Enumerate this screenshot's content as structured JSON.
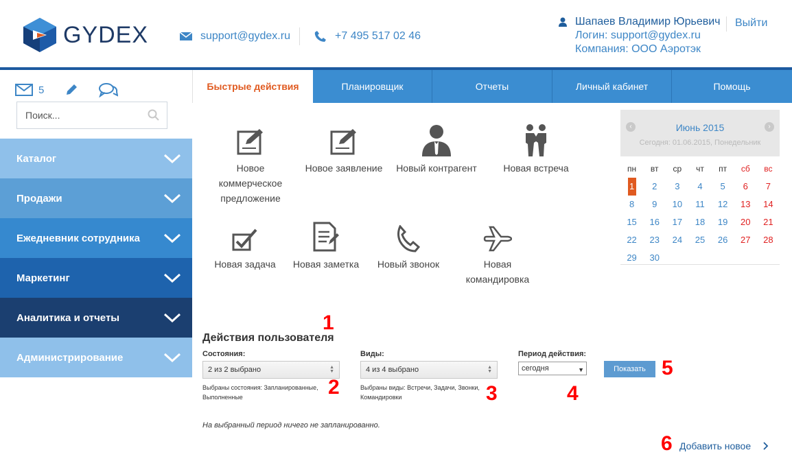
{
  "header": {
    "logo_text": "GYDEX",
    "email": "support@gydex.ru",
    "phone": "+7 495 517 02 46",
    "user_name": "Шапаев Владимир Юрьевич",
    "login_line": "Логин: support@gydex.ru",
    "company_line": "Компания: ООО Аэротэк",
    "logout": "Выйти"
  },
  "sidebar": {
    "mail_count": "5",
    "search_placeholder": "Поиск...",
    "menu": [
      {
        "label": "Каталог"
      },
      {
        "label": "Продажи"
      },
      {
        "label": "Ежедневник сотрудника"
      },
      {
        "label": "Маркетинг"
      },
      {
        "label": "Аналитика и отчеты"
      },
      {
        "label": "Администрирование"
      }
    ]
  },
  "tabs": [
    {
      "label": "Быстрые действия"
    },
    {
      "label": "Планировщик"
    },
    {
      "label": "Отчеты"
    },
    {
      "label": "Личный кабинет"
    },
    {
      "label": "Помощь"
    }
  ],
  "quick_actions": [
    {
      "label": "Новое коммерческое предложение",
      "icon": "document-pen-icon"
    },
    {
      "label": "Новое заявление",
      "icon": "document-pen-icon"
    },
    {
      "label": "Новый контрагент",
      "icon": "person-tie-icon"
    },
    {
      "label": "Новая встреча",
      "icon": "handshake-icon"
    },
    {
      "label": "Новая задача",
      "icon": "checkbox-icon"
    },
    {
      "label": "Новая заметка",
      "icon": "note-pen-icon"
    },
    {
      "label": "Новый звонок",
      "icon": "phone-icon"
    },
    {
      "label": "Новая командировка",
      "icon": "airplane-icon"
    }
  ],
  "calendar": {
    "title": "Июнь 2015",
    "subtitle": "Сегодня: 01.06.2015, Понедельник",
    "weekdays": [
      "пн",
      "вт",
      "ср",
      "чт",
      "пт",
      "сб",
      "вс"
    ],
    "weeks": [
      [
        "1",
        "2",
        "3",
        "4",
        "5",
        "6",
        "7"
      ],
      [
        "8",
        "9",
        "10",
        "11",
        "12",
        "13",
        "14"
      ],
      [
        "15",
        "16",
        "17",
        "18",
        "19",
        "20",
        "21"
      ],
      [
        "22",
        "23",
        "24",
        "25",
        "26",
        "27",
        "28"
      ],
      [
        "29",
        "30",
        "",
        "",
        "",
        "",
        ""
      ]
    ],
    "today": "1"
  },
  "user_actions": {
    "title": "Действия пользователя",
    "states_label": "Состояния:",
    "states_value": "2 из 2 выбрано",
    "states_note_1": "Выбраны состояния: Запланированные,",
    "states_note_2": "Выполненные",
    "types_label": "Виды:",
    "types_value": "4 из 4 выбрано",
    "types_note_1": "Выбраны виды: Встречи, Задачи, Звонки,",
    "types_note_2": "Командировки",
    "period_label": "Период действия:",
    "period_value": "сегодня",
    "show_button": "Показать",
    "empty_message": "На выбранный период ничего не запланированно.",
    "add_new": "Добавить новое"
  },
  "annotations": [
    "1",
    "2",
    "3",
    "4",
    "5",
    "6"
  ],
  "colors": {
    "accent": "#e05a20",
    "brand_blue": "#1d5aa0",
    "tab_blue": "#3b8dd1",
    "annotation_red": "#ff0000"
  }
}
